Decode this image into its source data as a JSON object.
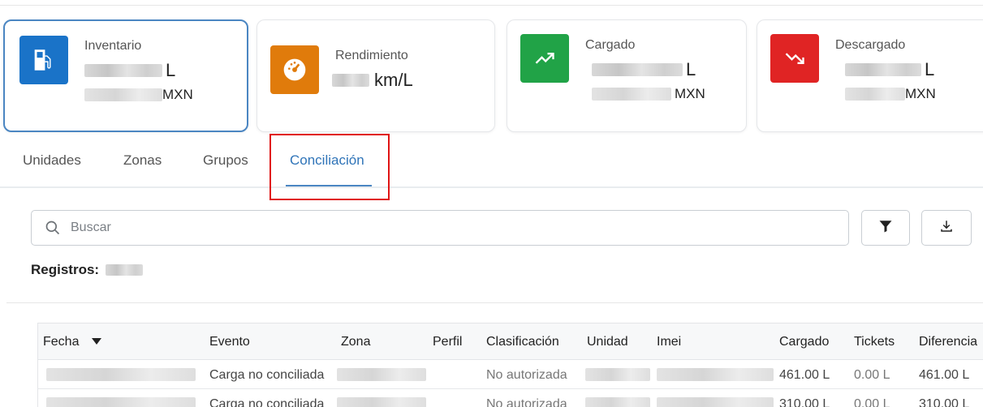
{
  "cards": [
    {
      "title": "Inventario",
      "unit1": "L",
      "unit2": "MXN",
      "icon": "fuel-pump-icon",
      "color": "#1a73c8"
    },
    {
      "title": "Rendimiento",
      "unit1": "km/L",
      "icon": "gauge-icon",
      "color": "#e07b0b"
    },
    {
      "title": "Cargado",
      "unit1": "L",
      "unit2": "MXN",
      "icon": "trending-up-icon",
      "color": "#21a347"
    },
    {
      "title": "Descargado",
      "unit1": "L",
      "unit2": "MXN",
      "icon": "trending-down-icon",
      "color": "#e02424"
    }
  ],
  "tabs": [
    {
      "label": "Unidades"
    },
    {
      "label": "Zonas"
    },
    {
      "label": "Grupos"
    },
    {
      "label": "Conciliación",
      "active": true
    }
  ],
  "search": {
    "placeholder": "Buscar"
  },
  "registros": {
    "label": "Registros:"
  },
  "table": {
    "columns": [
      "Fecha",
      "Evento",
      "Zona",
      "Perfil",
      "Clasificación",
      "Unidad",
      "Imei",
      "Cargado",
      "Tickets",
      "Diferencia"
    ],
    "rows": [
      {
        "evento": "Carga no conciliada",
        "clasificacion": "No autorizada",
        "cargado": "461.00 L",
        "tickets": "0.00 L",
        "diferencia": "461.00 L"
      },
      {
        "evento": "Carga no conciliada",
        "clasificacion": "No autorizada",
        "cargado": "310.00 L",
        "tickets": "0.00 L",
        "diferencia": "310.00 L"
      }
    ]
  }
}
